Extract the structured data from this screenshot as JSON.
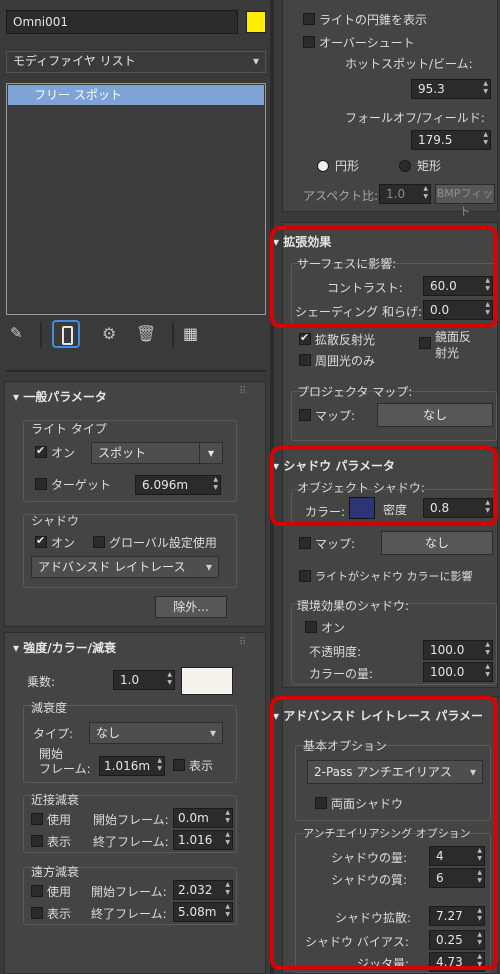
{
  "object": {
    "name": "Omni001",
    "color": "#ffee00"
  },
  "modifier_list": {
    "label": "モディファイヤ リスト"
  },
  "stack": {
    "items": [
      "フリー スポット"
    ]
  },
  "general": {
    "title": "一般パラメータ",
    "light_type": {
      "group": "ライト タイプ",
      "on_label": "オン",
      "on": true,
      "type": "スポット",
      "target_label": "ターゲット",
      "target_on": false,
      "target_value": "6.096m"
    },
    "shadow": {
      "group": "シャドウ",
      "on_label": "オン",
      "on": true,
      "global_label": "グローバル設定使用",
      "global_on": false,
      "type": "アドバンスド レイトレース"
    },
    "exclude": "除外..."
  },
  "intensity": {
    "title": "強度/カラー/減衰",
    "multiplier_label": "乗数:",
    "multiplier": "1.0",
    "color": "#f6f3ee",
    "decay": {
      "group": "減衰度",
      "type_label": "タイプ:",
      "type": "なし",
      "start_label1": "開始",
      "start_label2": "フレーム:",
      "start": "1.016m",
      "show": "表示"
    },
    "near": {
      "group": "近接減衰",
      "use": "使用",
      "show": "表示",
      "start_label": "開始フレーム:",
      "start": "0.0m",
      "end_label": "終了フレーム:",
      "end": "1.016"
    },
    "far": {
      "group": "遠方減衰",
      "use": "使用",
      "show": "表示",
      "start_label": "開始フレーム:",
      "start": "2.032",
      "end_label": "終了フレーム:",
      "end": "5.08m"
    }
  },
  "spot": {
    "show_cone": "ライトの円錐を表示",
    "overshoot": "オーバーシュート",
    "hotspot_label": "ホットスポット/ビーム:",
    "hotspot": "95.3",
    "falloff_label": "フォールオフ/フィールド:",
    "falloff": "179.5",
    "circle": "円形",
    "rect": "矩形",
    "aspect_label": "アスペクト比:",
    "aspect": "1.0",
    "bitmap_fit": "BMPフィット"
  },
  "advanced_effects": {
    "title": "拡張効果",
    "surface_group": "サーフェスに影響:",
    "contrast_label": "コントラスト:",
    "contrast": "60.0",
    "soften_label": "シェーディング 和らげ:",
    "soften": "0.0",
    "diffuse": "拡散反射光",
    "specular1": "鏡面反",
    "specular2": "射光",
    "ambient": "周囲光のみ",
    "projector_group": "プロジェクタ マップ:",
    "map_label": "マップ:",
    "map_value": "なし"
  },
  "shadow_params": {
    "title": "シャドウ パラメータ",
    "object_group": "オブジェクト シャドウ:",
    "color_label": "カラー:",
    "color": "#2e3574",
    "density_label": "密度",
    "density": "0.8",
    "map_label": "マップ:",
    "map_value": "なし",
    "light_affects": "ライトがシャドウ カラーに影響",
    "atmos_group": "環境効果のシャドウ:",
    "atmos_on": "オン",
    "opacity_label": "不透明度:",
    "opacity": "100.0",
    "color_amount_label": "カラーの量:",
    "color_amount": "100.0"
  },
  "adv_raytrace": {
    "title": "アドバンスド レイトレース パラメー",
    "basic_group": "基本オプション",
    "mode": "2-Pass アンチエイリアス",
    "two_sided": "両面シャドウ",
    "aa_group": "アンチエイリアシング オプション",
    "quality_label": "シャドウの量:",
    "quality": "4",
    "quality2_label": "シャドウの質:",
    "quality2": "6",
    "spread_label": "シャドウ拡散:",
    "spread": "7.27",
    "bias_label": "シャドウ バイアス:",
    "bias": "0.25",
    "jitter_label": "ジッタ量:",
    "jitter": "4.73"
  }
}
